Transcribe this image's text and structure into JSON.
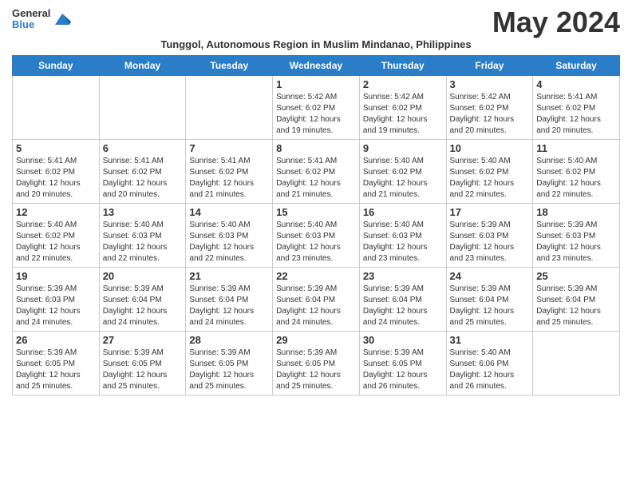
{
  "logo": {
    "text1": "General",
    "text2": "Blue"
  },
  "title": "May 2024",
  "subtitle": "Tunggol, Autonomous Region in Muslim Mindanao, Philippines",
  "headers": [
    "Sunday",
    "Monday",
    "Tuesday",
    "Wednesday",
    "Thursday",
    "Friday",
    "Saturday"
  ],
  "weeks": [
    [
      {
        "day": "",
        "sunrise": "",
        "sunset": "",
        "daylight": "",
        "empty": true
      },
      {
        "day": "",
        "sunrise": "",
        "sunset": "",
        "daylight": "",
        "empty": true
      },
      {
        "day": "",
        "sunrise": "",
        "sunset": "",
        "daylight": "",
        "empty": true
      },
      {
        "day": "1",
        "sunrise": "Sunrise: 5:42 AM",
        "sunset": "Sunset: 6:02 PM",
        "daylight": "Daylight: 12 hours and 19 minutes."
      },
      {
        "day": "2",
        "sunrise": "Sunrise: 5:42 AM",
        "sunset": "Sunset: 6:02 PM",
        "daylight": "Daylight: 12 hours and 19 minutes."
      },
      {
        "day": "3",
        "sunrise": "Sunrise: 5:42 AM",
        "sunset": "Sunset: 6:02 PM",
        "daylight": "Daylight: 12 hours and 20 minutes."
      },
      {
        "day": "4",
        "sunrise": "Sunrise: 5:41 AM",
        "sunset": "Sunset: 6:02 PM",
        "daylight": "Daylight: 12 hours and 20 minutes."
      }
    ],
    [
      {
        "day": "5",
        "sunrise": "Sunrise: 5:41 AM",
        "sunset": "Sunset: 6:02 PM",
        "daylight": "Daylight: 12 hours and 20 minutes."
      },
      {
        "day": "6",
        "sunrise": "Sunrise: 5:41 AM",
        "sunset": "Sunset: 6:02 PM",
        "daylight": "Daylight: 12 hours and 20 minutes."
      },
      {
        "day": "7",
        "sunrise": "Sunrise: 5:41 AM",
        "sunset": "Sunset: 6:02 PM",
        "daylight": "Daylight: 12 hours and 21 minutes."
      },
      {
        "day": "8",
        "sunrise": "Sunrise: 5:41 AM",
        "sunset": "Sunset: 6:02 PM",
        "daylight": "Daylight: 12 hours and 21 minutes."
      },
      {
        "day": "9",
        "sunrise": "Sunrise: 5:40 AM",
        "sunset": "Sunset: 6:02 PM",
        "daylight": "Daylight: 12 hours and 21 minutes."
      },
      {
        "day": "10",
        "sunrise": "Sunrise: 5:40 AM",
        "sunset": "Sunset: 6:02 PM",
        "daylight": "Daylight: 12 hours and 22 minutes."
      },
      {
        "day": "11",
        "sunrise": "Sunrise: 5:40 AM",
        "sunset": "Sunset: 6:02 PM",
        "daylight": "Daylight: 12 hours and 22 minutes."
      }
    ],
    [
      {
        "day": "12",
        "sunrise": "Sunrise: 5:40 AM",
        "sunset": "Sunset: 6:02 PM",
        "daylight": "Daylight: 12 hours and 22 minutes."
      },
      {
        "day": "13",
        "sunrise": "Sunrise: 5:40 AM",
        "sunset": "Sunset: 6:03 PM",
        "daylight": "Daylight: 12 hours and 22 minutes."
      },
      {
        "day": "14",
        "sunrise": "Sunrise: 5:40 AM",
        "sunset": "Sunset: 6:03 PM",
        "daylight": "Daylight: 12 hours and 22 minutes."
      },
      {
        "day": "15",
        "sunrise": "Sunrise: 5:40 AM",
        "sunset": "Sunset: 6:03 PM",
        "daylight": "Daylight: 12 hours and 23 minutes."
      },
      {
        "day": "16",
        "sunrise": "Sunrise: 5:40 AM",
        "sunset": "Sunset: 6:03 PM",
        "daylight": "Daylight: 12 hours and 23 minutes."
      },
      {
        "day": "17",
        "sunrise": "Sunrise: 5:39 AM",
        "sunset": "Sunset: 6:03 PM",
        "daylight": "Daylight: 12 hours and 23 minutes."
      },
      {
        "day": "18",
        "sunrise": "Sunrise: 5:39 AM",
        "sunset": "Sunset: 6:03 PM",
        "daylight": "Daylight: 12 hours and 23 minutes."
      }
    ],
    [
      {
        "day": "19",
        "sunrise": "Sunrise: 5:39 AM",
        "sunset": "Sunset: 6:03 PM",
        "daylight": "Daylight: 12 hours and 24 minutes."
      },
      {
        "day": "20",
        "sunrise": "Sunrise: 5:39 AM",
        "sunset": "Sunset: 6:04 PM",
        "daylight": "Daylight: 12 hours and 24 minutes."
      },
      {
        "day": "21",
        "sunrise": "Sunrise: 5:39 AM",
        "sunset": "Sunset: 6:04 PM",
        "daylight": "Daylight: 12 hours and 24 minutes."
      },
      {
        "day": "22",
        "sunrise": "Sunrise: 5:39 AM",
        "sunset": "Sunset: 6:04 PM",
        "daylight": "Daylight: 12 hours and 24 minutes."
      },
      {
        "day": "23",
        "sunrise": "Sunrise: 5:39 AM",
        "sunset": "Sunset: 6:04 PM",
        "daylight": "Daylight: 12 hours and 24 minutes."
      },
      {
        "day": "24",
        "sunrise": "Sunrise: 5:39 AM",
        "sunset": "Sunset: 6:04 PM",
        "daylight": "Daylight: 12 hours and 25 minutes."
      },
      {
        "day": "25",
        "sunrise": "Sunrise: 5:39 AM",
        "sunset": "Sunset: 6:04 PM",
        "daylight": "Daylight: 12 hours and 25 minutes."
      }
    ],
    [
      {
        "day": "26",
        "sunrise": "Sunrise: 5:39 AM",
        "sunset": "Sunset: 6:05 PM",
        "daylight": "Daylight: 12 hours and 25 minutes."
      },
      {
        "day": "27",
        "sunrise": "Sunrise: 5:39 AM",
        "sunset": "Sunset: 6:05 PM",
        "daylight": "Daylight: 12 hours and 25 minutes."
      },
      {
        "day": "28",
        "sunrise": "Sunrise: 5:39 AM",
        "sunset": "Sunset: 6:05 PM",
        "daylight": "Daylight: 12 hours and 25 minutes."
      },
      {
        "day": "29",
        "sunrise": "Sunrise: 5:39 AM",
        "sunset": "Sunset: 6:05 PM",
        "daylight": "Daylight: 12 hours and 25 minutes."
      },
      {
        "day": "30",
        "sunrise": "Sunrise: 5:39 AM",
        "sunset": "Sunset: 6:05 PM",
        "daylight": "Daylight: 12 hours and 26 minutes."
      },
      {
        "day": "31",
        "sunrise": "Sunrise: 5:40 AM",
        "sunset": "Sunset: 6:06 PM",
        "daylight": "Daylight: 12 hours and 26 minutes."
      },
      {
        "day": "",
        "sunrise": "",
        "sunset": "",
        "daylight": "",
        "empty": true
      }
    ]
  ]
}
